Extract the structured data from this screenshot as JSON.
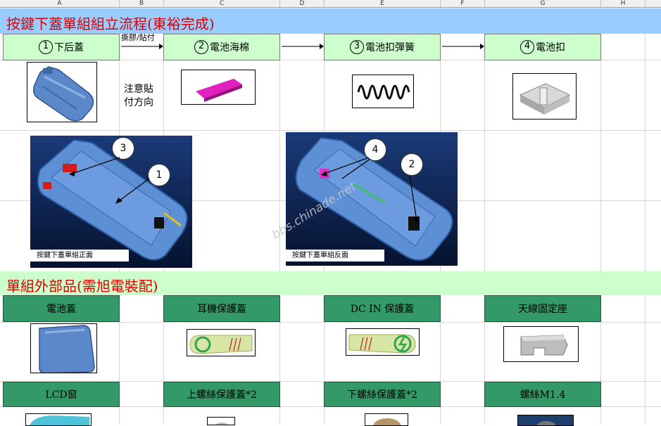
{
  "columns": [
    "A",
    "B",
    "C",
    "D",
    "E",
    "F",
    "G",
    "H"
  ],
  "title_main": "按鍵下蓋單組組立流程(東裕完成)",
  "steps": [
    {
      "num": "1",
      "label": "下后蓋"
    },
    {
      "num": "2",
      "label": "電池海棉"
    },
    {
      "num": "3",
      "label": "電池扣彈簧"
    },
    {
      "num": "4",
      "label": "電池扣"
    }
  ],
  "arrow_note": "撕膠/貼付",
  "note_text": [
    "注意貼",
    "付方向"
  ],
  "photo_front": {
    "caption": "按鍵下蓋單組正面",
    "callouts": [
      "3",
      "1"
    ]
  },
  "photo_back": {
    "caption": "按鍵下蓋單組反面",
    "callouts": [
      "4",
      "2"
    ]
  },
  "watermark": "bbs.chinade.net",
  "title_sub": "單組外部品(需旭電裝配)",
  "parts_row1": [
    "電池蓋",
    "耳機保護蓋",
    "DC IN 保護蓋",
    "天線固定座"
  ],
  "parts_row2": [
    "LCD窗",
    "上螺絲保護蓋*2",
    "下螺絲保護蓋*2",
    "螺絲M1.4"
  ],
  "colors": {
    "title": "#e00000",
    "band_blue": "#99ccff",
    "band_green": "#ccffcc",
    "part_header": "#339966"
  }
}
